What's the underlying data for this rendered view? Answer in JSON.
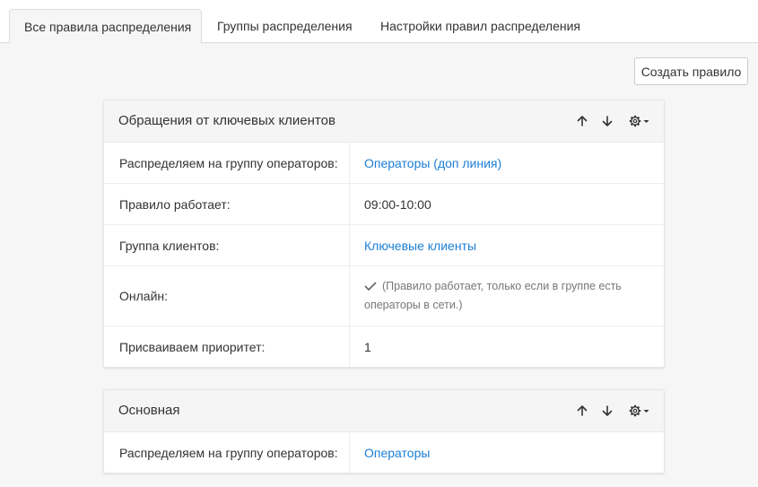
{
  "tabs": [
    {
      "label": "Все правила распределения",
      "active": true
    },
    {
      "label": "Группы распределения",
      "active": false
    },
    {
      "label": "Настройки правил распределения",
      "active": false
    }
  ],
  "toolbar": {
    "create_label": "Создать правило"
  },
  "rules": [
    {
      "title": "Обращения от ключевых клиентов",
      "rows": {
        "operator_group_label": "Распределяем на группу операторов:",
        "operator_group_value": "Операторы (доп линия)",
        "schedule_label": "Правило работает:",
        "schedule_value": "09:00-10:00",
        "client_group_label": "Группа клиентов:",
        "client_group_value": "Ключевые клиенты",
        "online_label": "Онлайн:",
        "online_checked": true,
        "online_note": "(Правило работает, только если в группе есть операторы в сети.)",
        "priority_label": "Присваиваем приоритет:",
        "priority_value": "1"
      }
    },
    {
      "title": "Основная",
      "rows": {
        "operator_group_label": "Распределяем на группу операторов:",
        "operator_group_value": "Операторы"
      }
    }
  ],
  "icons": {
    "move_up": "arrow-up-icon",
    "move_down": "arrow-down-icon",
    "settings": "gear-icon",
    "dropdown": "caret-down-icon",
    "online": "check-icon"
  },
  "colors": {
    "link": "#1c7ed6",
    "background": "#f6f6f6"
  }
}
